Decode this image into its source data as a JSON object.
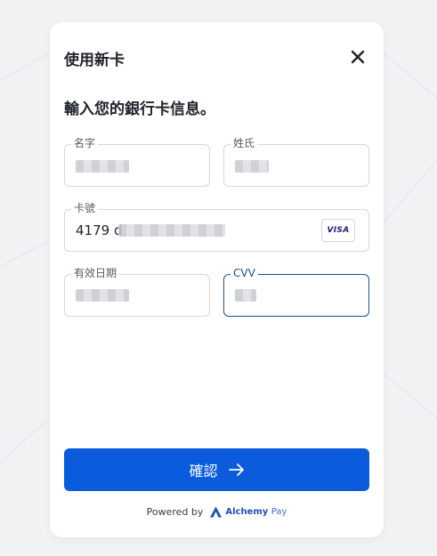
{
  "dialog": {
    "title": "使用新卡",
    "subtitle": "輸入您的銀行卡信息。"
  },
  "form": {
    "first_name": {
      "label": "名字",
      "value": ""
    },
    "last_name": {
      "label": "姓氏",
      "value": ""
    },
    "card_number": {
      "label": "卡號",
      "value_prefix": "4179 d",
      "brand_badge": "VISA"
    },
    "expiry": {
      "label": "有效日期",
      "value": ""
    },
    "cvv": {
      "label": "CVV",
      "value": ""
    }
  },
  "actions": {
    "confirm_label": "確認"
  },
  "footer": {
    "powered_by": "Powered by",
    "brand_name": "Alchemy",
    "brand_suffix": "Pay"
  },
  "colors": {
    "primary": "#0a5cdc",
    "focus_border": "#1b4f8f",
    "brand": "#1e4fb5"
  },
  "icons": {
    "close": "close-icon",
    "arrow": "arrow-right-icon",
    "logo": "alchemy-pay-logo-icon"
  }
}
